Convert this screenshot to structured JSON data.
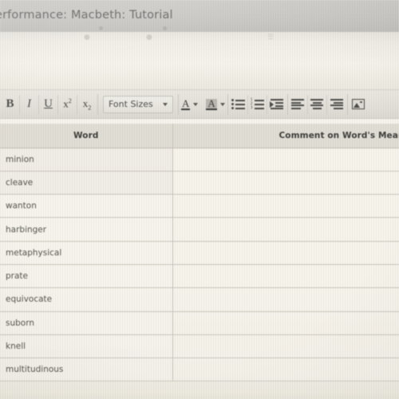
{
  "window": {
    "title": "erformance: Macbeth: Tutorial",
    "title_truncated_left": true
  },
  "toolbar": {
    "groups": [
      {
        "name": "text-style",
        "buttons": [
          {
            "id": "bold",
            "label": "B",
            "icon": "bold-icon"
          },
          {
            "id": "italic",
            "label": "I",
            "icon": "italic-icon"
          },
          {
            "id": "underline",
            "label": "U",
            "icon": "underline-icon"
          },
          {
            "id": "superscript",
            "label": "x",
            "script": "2",
            "icon": "superscript-icon"
          },
          {
            "id": "subscript",
            "label": "x",
            "script": "2",
            "icon": "subscript-icon"
          }
        ]
      }
    ],
    "font_sizes": {
      "label": "Font Sizes",
      "icon": "chevron-down-icon"
    },
    "text_color": {
      "label": "A",
      "icon": "text-color-icon"
    },
    "highlight_color": {
      "label": "A",
      "icon": "highlight-color-icon"
    },
    "list_buttons": [
      {
        "id": "bulleted-list",
        "icon": "bulleted-list-icon"
      },
      {
        "id": "numbered-list",
        "icon": "numbered-list-icon"
      },
      {
        "id": "indent",
        "icon": "indent-icon"
      }
    ],
    "align_buttons": [
      {
        "id": "align-left",
        "icon": "align-left-icon"
      },
      {
        "id": "align-center",
        "icon": "align-center-icon"
      },
      {
        "id": "align-right",
        "icon": "align-right-icon"
      }
    ],
    "insert_image": {
      "id": "insert-image",
      "icon": "image-icon"
    }
  },
  "table": {
    "headers": [
      "Word",
      "Comment on Word's Meaning"
    ],
    "rows": [
      {
        "word": "minion",
        "comment": ""
      },
      {
        "word": "cleave",
        "comment": ""
      },
      {
        "word": "wanton",
        "comment": ""
      },
      {
        "word": "harbinger",
        "comment": ""
      },
      {
        "word": "metaphysical",
        "comment": ""
      },
      {
        "word": "prate",
        "comment": ""
      },
      {
        "word": "equivocate",
        "comment": ""
      },
      {
        "word": "suborn",
        "comment": ""
      },
      {
        "word": "knell",
        "comment": ""
      },
      {
        "word": "multitudinous",
        "comment": ""
      }
    ]
  },
  "colors": {
    "titlebar_bg": "#c5c4c0",
    "toolbar_bg": "#e3e1d9",
    "page_bg": "#f3f1e9",
    "header_row_bg": "#e0ddd4",
    "grid_line": "#c9c6bc",
    "body_text": "#56564f",
    "title_text": "#5a5a58"
  }
}
